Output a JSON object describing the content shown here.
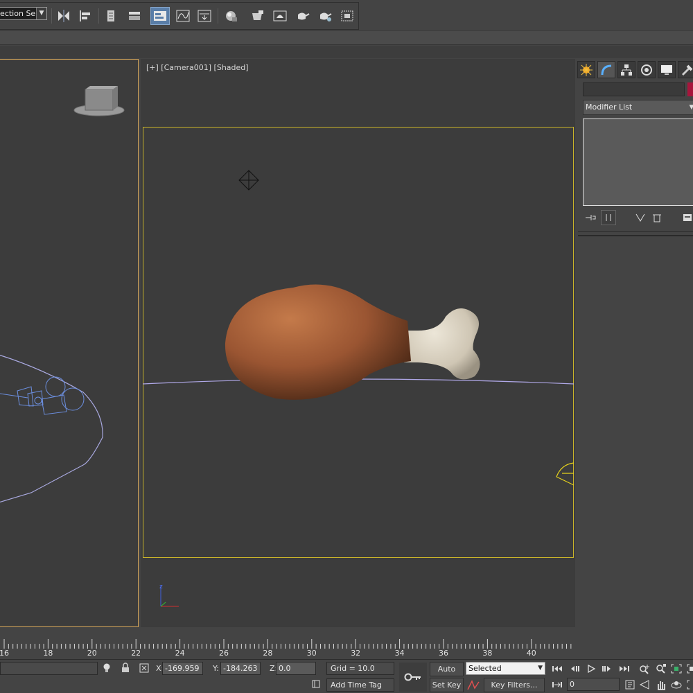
{
  "toolbar": {
    "selection_set": "Edit Named Selection Sets",
    "selection_set_visible": "lection Se"
  },
  "viewport_camera": {
    "label": "[+] [Camera001] [Shaded]"
  },
  "command_panel": {
    "modifier_list": "Modifier List",
    "object_color": "#a8153c"
  },
  "timeline": {
    "ticks": [
      "16",
      "18",
      "20",
      "22",
      "24",
      "26",
      "28",
      "30",
      "32",
      "34",
      "36",
      "38",
      "40"
    ]
  },
  "status": {
    "x_label": "X:",
    "x_value": "-169.959",
    "y_label": "Y:",
    "y_value": "-184.263",
    "z_label": "Z:",
    "z_value": "0.0",
    "grid": "Grid = 10.0",
    "add_time_tag": "Add Time Tag",
    "auto_key": "Auto Key",
    "set_key": "Set Key",
    "selected": "Selected",
    "key_filters": "Key Filters...",
    "frame": "0"
  },
  "colors": {
    "safe_frame": "#c9b42a",
    "viewport_active_border": "#d8a85a",
    "drumstick_meat": "#9a5a35",
    "bone": "#d6cfc0",
    "wireframe": "#6c8fe0"
  }
}
